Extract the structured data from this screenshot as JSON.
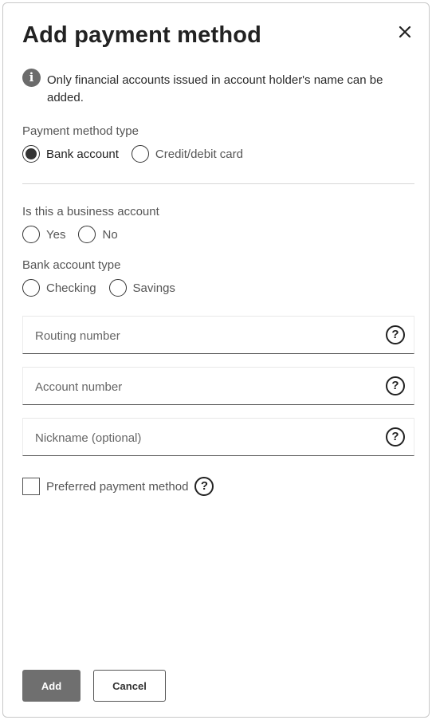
{
  "dialog": {
    "title": "Add payment method",
    "close_icon": "close-icon"
  },
  "info": {
    "icon": "info-icon",
    "icon_glyph": "i",
    "text": "Only financial accounts issued in account holder's name can be added."
  },
  "payment_method_type": {
    "label": "Payment method type",
    "options": [
      {
        "label": "Bank account",
        "selected": true
      },
      {
        "label": "Credit/debit card",
        "selected": false
      }
    ]
  },
  "business_account": {
    "label": "Is this a business account",
    "options": [
      {
        "label": "Yes",
        "selected": false
      },
      {
        "label": "No",
        "selected": false
      }
    ]
  },
  "bank_account_type": {
    "label": "Bank account type",
    "options": [
      {
        "label": "Checking",
        "selected": false
      },
      {
        "label": "Savings",
        "selected": false
      }
    ]
  },
  "fields": [
    {
      "placeholder": "Routing number",
      "value": "",
      "help_icon": "question-circle-icon"
    },
    {
      "placeholder": "Account number",
      "value": "",
      "help_icon": "question-circle-icon"
    },
    {
      "placeholder": "Nickname (optional)",
      "value": "",
      "help_icon": "question-circle-icon"
    }
  ],
  "help_glyph": "?",
  "preferred": {
    "label": "Preferred payment method",
    "checked": false,
    "help_icon": "question-circle-icon"
  },
  "buttons": {
    "add": "Add",
    "cancel": "Cancel"
  },
  "colors": {
    "primary_button": "#6f6f6f",
    "text": "#2a2a2a",
    "muted_text": "#555555"
  }
}
